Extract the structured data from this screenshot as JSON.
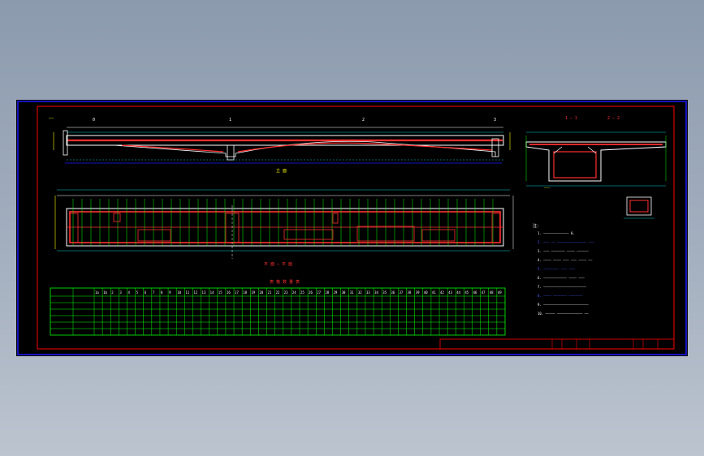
{
  "drawing": {
    "view_labels": {
      "elevation": "立 面",
      "plan": "平 面 — 平 面",
      "table_title": "表 格 数 量 表",
      "section_a": "1 — 1",
      "section_b": "2 — 2"
    },
    "pier_marks": [
      "0",
      "1",
      "2",
      "3"
    ],
    "notes_header": "注：",
    "notes": [
      "1. ————————————— 0.",
      "2. ——— —— ——————————————— ———",
      "3. ——— ——————— ———— ——————",
      "4. ———— ———— ——— ——— ———— ——",
      "5. ———————— ——— ———",
      "6. ———————————— ———— ———",
      "7. ——————————————————————",
      "8. ———— ——————— ———————",
      "9. ———————————————————————",
      "10. ————— ————————————— ——"
    ],
    "table_header_cells": [
      "1a",
      "1b",
      "2",
      "3",
      "4",
      "5",
      "6",
      "7",
      "8",
      "9",
      "10",
      "11",
      "12",
      "13",
      "14",
      "15",
      "16",
      "17",
      "18",
      "19",
      "20",
      "21",
      "22",
      "23",
      "24",
      "25",
      "26",
      "27",
      "28",
      "29",
      "30",
      "31",
      "32",
      "33",
      "34",
      "35",
      "36",
      "37",
      "38",
      "39",
      "40",
      "41",
      "42",
      "43",
      "44",
      "45",
      "46",
      "47",
      "48",
      "49"
    ],
    "title_block": {
      "project": "",
      "cells": [
        "",
        "",
        "",
        "",
        "",
        ""
      ]
    }
  },
  "colors": {
    "background": "#000000",
    "frame_blue": "#0000ff",
    "frame_red": "#ff0000",
    "outline_white": "#ffffff",
    "dim_cyan": "#00ffff",
    "grid_green": "#00ff00",
    "text_yellow": "#ffff00",
    "rebar_red": "#ff2020"
  }
}
